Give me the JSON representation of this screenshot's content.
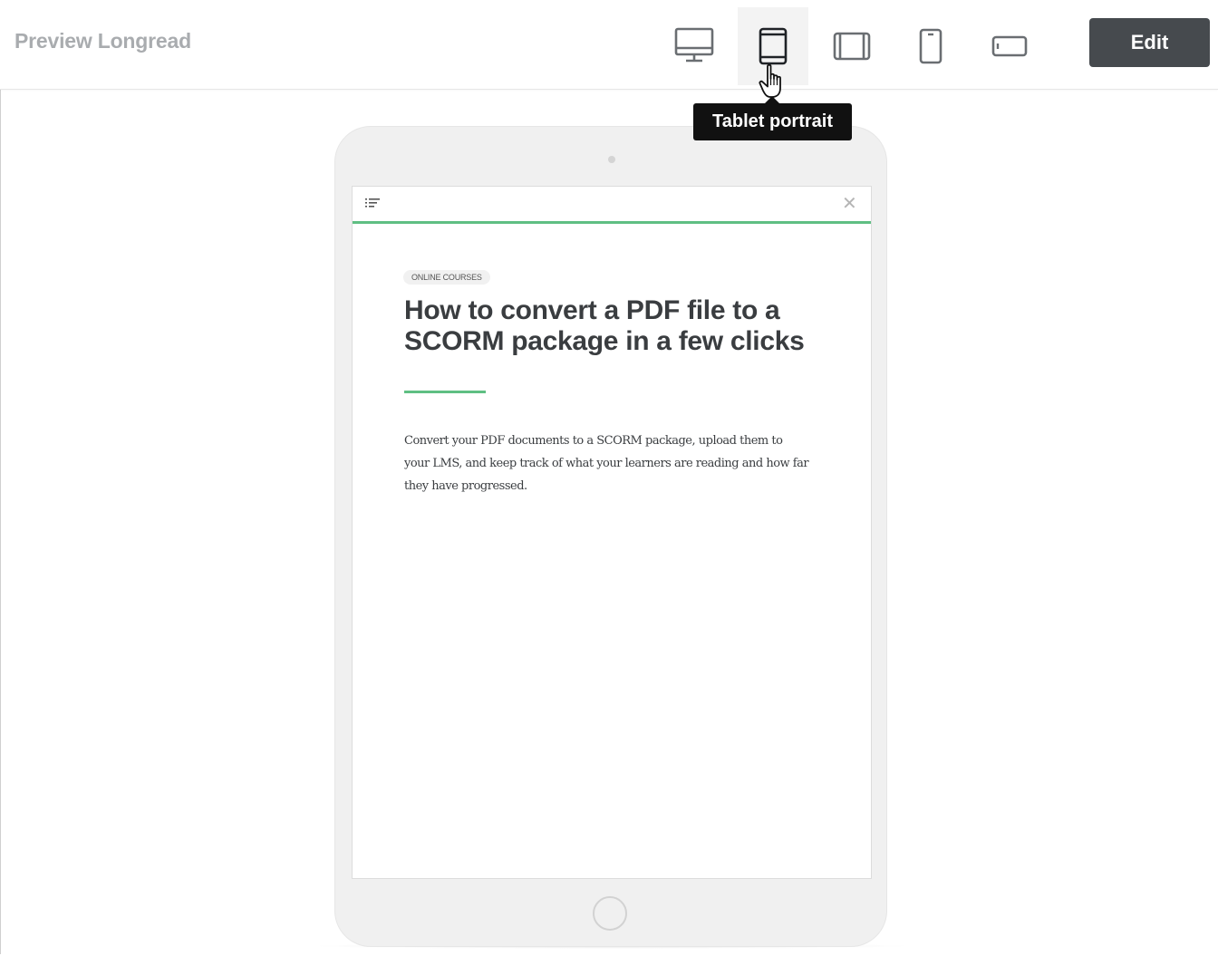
{
  "header": {
    "title": "Preview Longread",
    "edit_label": "Edit"
  },
  "devices": [
    {
      "name": "desktop",
      "icon": "monitor-icon"
    },
    {
      "name": "tablet-portrait",
      "icon": "tablet-portrait-icon",
      "active": true
    },
    {
      "name": "tablet-landscape",
      "icon": "tablet-landscape-icon"
    },
    {
      "name": "phone-portrait",
      "icon": "phone-portrait-icon"
    },
    {
      "name": "phone-landscape",
      "icon": "phone-landscape-icon"
    }
  ],
  "tooltip": {
    "text": "Tablet portrait"
  },
  "article": {
    "tag": "ONLINE COURSES",
    "title": "How to convert a PDF file to a SCORM package in a few clicks",
    "body": "Convert your PDF documents to a SCORM package, upload them to your LMS, and keep track of what your learners are reading and how far they have progressed."
  },
  "colors": {
    "accent_green": "#5fbf83",
    "edit_button": "#464a4e",
    "title_gray": "#a9acaf",
    "tooltip_bg": "#111111"
  }
}
